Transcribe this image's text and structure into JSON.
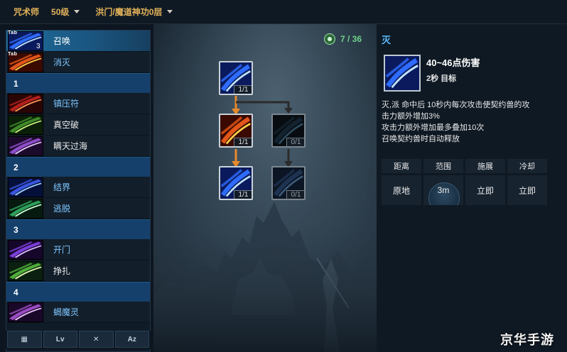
{
  "topbar": {
    "class_label": "咒术师",
    "level_label": "50级",
    "dungeon_label": "洪门/魔道神功0层"
  },
  "sidebar": {
    "items": [
      {
        "type": "skill",
        "name": "召唤",
        "hotkey": "Tab",
        "level": "3",
        "selected": true,
        "name_color": "blue",
        "art": "blue-slash"
      },
      {
        "type": "skill",
        "name": "消灭",
        "hotkey": "Tab",
        "level": "",
        "selected": false,
        "name_color": "blue",
        "art": "fire-burst"
      },
      {
        "type": "group",
        "label": "1"
      },
      {
        "type": "skill",
        "name": "镇压符",
        "hotkey": "",
        "level": "",
        "selected": false,
        "name_color": "blue",
        "art": "red-seal"
      },
      {
        "type": "skill",
        "name": "真空破",
        "hotkey": "",
        "level": "",
        "selected": false,
        "name_color": "white",
        "art": "green-figure"
      },
      {
        "type": "skill",
        "name": "瞒天过海",
        "hotkey": "",
        "level": "",
        "selected": false,
        "name_color": "white",
        "art": "purple-ghost"
      },
      {
        "type": "group",
        "label": "2"
      },
      {
        "type": "skill",
        "name": "结界",
        "hotkey": "",
        "level": "",
        "selected": false,
        "name_color": "blue",
        "art": "blue-ring"
      },
      {
        "type": "skill",
        "name": "逃脱",
        "hotkey": "",
        "level": "",
        "selected": false,
        "name_color": "blue",
        "art": "green-dash"
      },
      {
        "type": "group",
        "label": "3"
      },
      {
        "type": "skill",
        "name": "开门",
        "hotkey": "",
        "level": "",
        "selected": false,
        "name_color": "blue",
        "art": "purple-vortex"
      },
      {
        "type": "skill",
        "name": "挣扎",
        "hotkey": "",
        "level": "",
        "selected": false,
        "name_color": "white",
        "art": "green-swirl"
      },
      {
        "type": "group",
        "label": "4"
      },
      {
        "type": "skill",
        "name": "蝎魔灵",
        "hotkey": "",
        "level": "",
        "selected": false,
        "name_color": "blue",
        "art": "purple-scorpion"
      }
    ],
    "bottom_tabs": [
      {
        "label": "▦",
        "icon": "grid-icon"
      },
      {
        "label": "Lv",
        "icon": "level-icon"
      },
      {
        "label": "✕",
        "icon": "crossed-swords-icon"
      },
      {
        "label": "Az",
        "icon": "sort-alpha-icon"
      }
    ]
  },
  "tree": {
    "points_label": "7 / 36",
    "points_icon": "skill-point-icon",
    "nodes": [
      {
        "id": "root",
        "badge": "1/1",
        "art": "blue-slash",
        "dim": false
      },
      {
        "id": "mid-left",
        "badge": "1/1",
        "art": "fire-burst",
        "dim": false
      },
      {
        "id": "mid-right",
        "badge": "0/1",
        "art": "dark-figure",
        "dim": true
      },
      {
        "id": "bot-left",
        "badge": "1/1",
        "art": "blue-slash",
        "dim": false
      },
      {
        "id": "bot-right",
        "badge": "0/1",
        "art": "blue-slash-dark",
        "dim": true
      }
    ]
  },
  "detail": {
    "title": "灭",
    "damage": "40~46点伤害",
    "cast": "2秒 目标",
    "description": [
      "灭,派 命中后 10秒内每次攻击使契约兽的攻",
      "击力额外增加3%",
      "攻击力额外增加最多叠加10次",
      "召唤契约兽时自动释放"
    ],
    "stats_headers": [
      "距离",
      "范围",
      "施展",
      "冷却"
    ],
    "stats_values": [
      "原地",
      "3m",
      "立即",
      "立即"
    ]
  },
  "watermark": "京华手游",
  "colors": {
    "accent_gold": "#e3b35b",
    "accent_blue": "#5bbcff",
    "points_green": "#6fd28a",
    "selected_row": "#1f6b9c",
    "group_header": "#15406b"
  }
}
